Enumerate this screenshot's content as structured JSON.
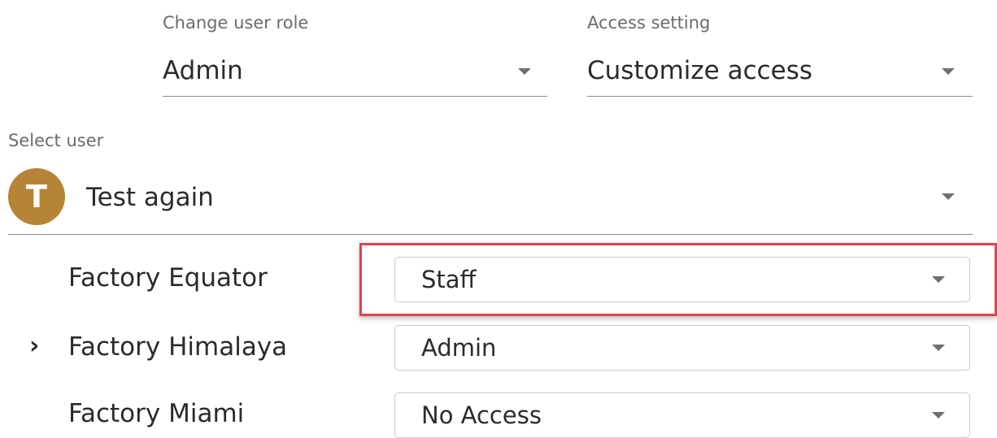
{
  "role": {
    "label": "Change user role",
    "value": "Admin"
  },
  "access": {
    "label": "Access setting",
    "value": "Customize access"
  },
  "user": {
    "label": "Select user",
    "avatar_initial": "T",
    "avatar_color": "#b58535",
    "name": "Test again"
  },
  "factories": [
    {
      "name": "Factory Equator",
      "role": "Staff",
      "expandable": false
    },
    {
      "name": "Factory Himalaya",
      "role": "Admin",
      "expandable": true
    },
    {
      "name": "Factory Miami",
      "role": "No Access",
      "expandable": false
    }
  ],
  "highlight_color": "#e0434b"
}
